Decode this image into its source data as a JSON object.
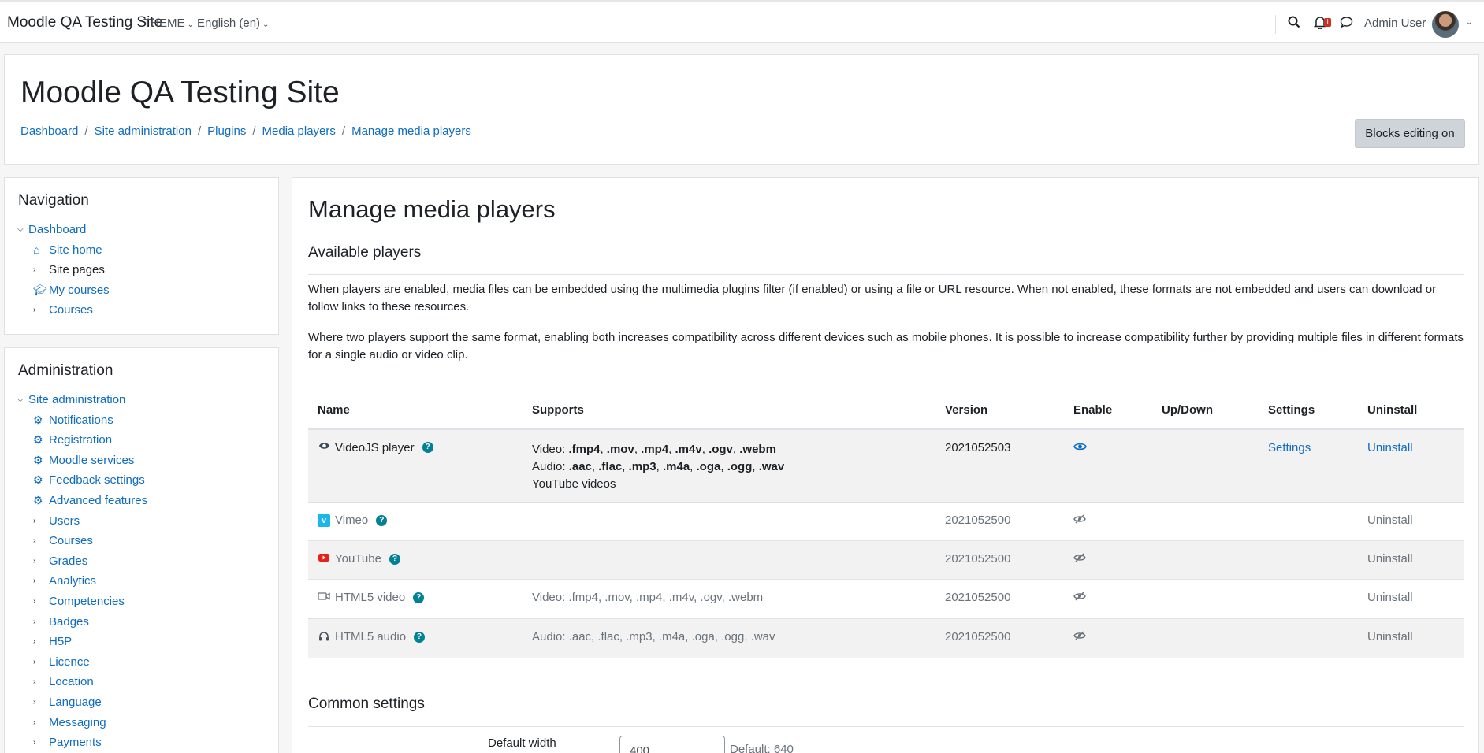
{
  "navbar": {
    "brand": "Moodle QA Testing Site",
    "theme_menu": "THEME",
    "language_menu": "English (en)",
    "notification_count": "1",
    "user_name": "Admin User"
  },
  "header": {
    "title": "Moodle QA Testing Site",
    "breadcrumb": [
      "Dashboard",
      "Site administration",
      "Plugins",
      "Media players",
      "Manage media players"
    ],
    "blocks_button": "Blocks editing on"
  },
  "navigation": {
    "title": "Navigation",
    "items": [
      {
        "label": "Dashboard"
      },
      {
        "label": "Site home"
      },
      {
        "label": "Site pages"
      },
      {
        "label": "My courses"
      },
      {
        "label": "Courses"
      }
    ]
  },
  "administration": {
    "title": "Administration",
    "items": [
      {
        "label": "Site administration"
      },
      {
        "label": "Notifications"
      },
      {
        "label": "Registration"
      },
      {
        "label": "Moodle services"
      },
      {
        "label": "Feedback settings"
      },
      {
        "label": "Advanced features"
      },
      {
        "label": "Users"
      },
      {
        "label": "Courses"
      },
      {
        "label": "Grades"
      },
      {
        "label": "Analytics"
      },
      {
        "label": "Competencies"
      },
      {
        "label": "Badges"
      },
      {
        "label": "H5P"
      },
      {
        "label": "Licence"
      },
      {
        "label": "Location"
      },
      {
        "label": "Language"
      },
      {
        "label": "Messaging"
      },
      {
        "label": "Payments"
      }
    ]
  },
  "main": {
    "heading": "Manage media players",
    "available_heading": "Available players",
    "para1": "When players are enabled, media files can be embedded using the multimedia plugins filter (if enabled) or using a file or URL resource. When not enabled, these formats are not embedded and users can download or follow links to these resources.",
    "para2": "Where two players support the same format, enabling both increases compatibility across different devices such as mobile phones. It is possible to increase compatibility further by providing multiple files in different formats for a single audio or video clip.",
    "table": {
      "headers": [
        "Name",
        "Supports",
        "Version",
        "Enable",
        "Up/Down",
        "Settings",
        "Uninstall"
      ],
      "rows": [
        {
          "name": "VideoJS player",
          "icon": "videojs-icon",
          "video_label": "Video: ",
          "video_formats": [
            ".fmp4",
            ".mov",
            ".mp4",
            ".m4v",
            ".ogv",
            ".webm"
          ],
          "audio_label": "Audio: ",
          "audio_formats": [
            ".aac",
            ".flac",
            ".mp3",
            ".m4a",
            ".oga",
            ".ogg",
            ".wav"
          ],
          "extra": "YouTube videos",
          "version": "2021052503",
          "enabled": true,
          "settings": "Settings",
          "uninstall": "Uninstall"
        },
        {
          "name": "Vimeo",
          "icon": "vimeo-icon",
          "supports": "",
          "version": "2021052500",
          "enabled": false,
          "uninstall": "Uninstall"
        },
        {
          "name": "YouTube",
          "icon": "youtube-icon",
          "supports": "",
          "version": "2021052500",
          "enabled": false,
          "uninstall": "Uninstall"
        },
        {
          "name": "HTML5 video",
          "icon": "video-camera-icon",
          "supports": "Video: .fmp4, .mov, .mp4, .m4v, .ogv, .webm",
          "version": "2021052500",
          "enabled": false,
          "uninstall": "Uninstall"
        },
        {
          "name": "HTML5 audio",
          "icon": "headphones-icon",
          "supports": "Audio: .aac, .flac, .mp3, .m4a, .oga, .ogg, .wav",
          "version": "2021052500",
          "enabled": false,
          "uninstall": "Uninstall"
        }
      ]
    },
    "common_heading": "Common settings",
    "default_width_label": "Default width",
    "default_width_value": "400",
    "default_width_hint": "Default: 640"
  },
  "colors": {
    "link": "#0f6cbf",
    "help": "#008196",
    "badge": "#ca3120"
  }
}
